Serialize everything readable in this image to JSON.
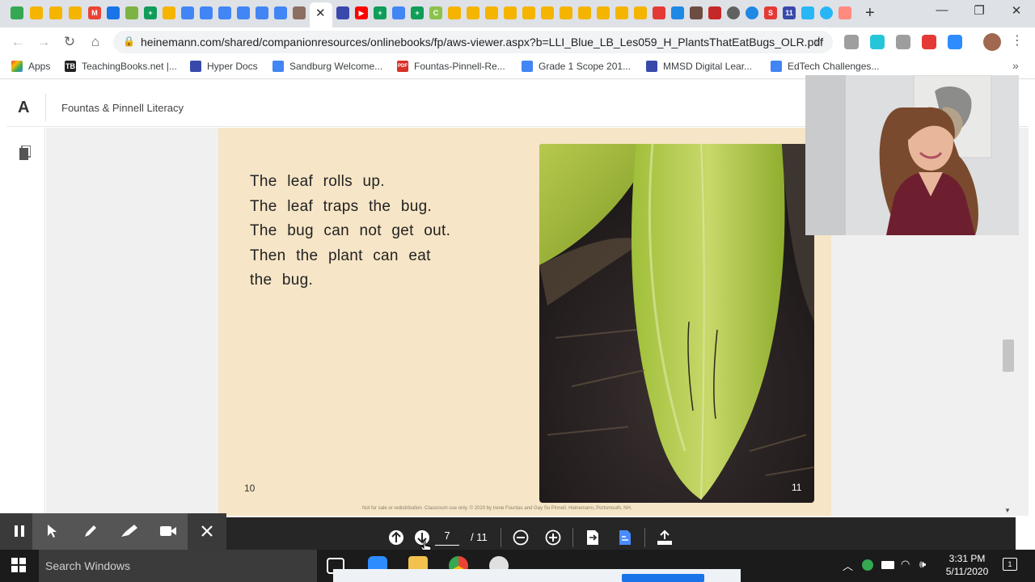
{
  "browser": {
    "tab_close": "✕",
    "new_tab": "+",
    "window": {
      "minimize": "—",
      "restore": "❐",
      "close": "✕"
    },
    "nav": {
      "back": "←",
      "forward": "→",
      "reload": "↻",
      "home": "⌂"
    },
    "url": "heinemann.com/shared/companionresources/onlinebooks/fp/aws-viewer.aspx?b=LLI_Blue_LB_Les059_H_PlantsThatEatBugs_OLR.pdf",
    "star": "☆",
    "kebab": "⋮",
    "bookmarks": [
      {
        "label": "Apps"
      },
      {
        "label": "TeachingBooks.net |..."
      },
      {
        "label": "Hyper Docs"
      },
      {
        "label": "Sandburg Welcome..."
      },
      {
        "label": "Fountas-Pinnell-Re..."
      },
      {
        "label": "Grade 1 Scope 201..."
      },
      {
        "label": "MMSD Digital Lear..."
      },
      {
        "label": "EdTech Challenges..."
      }
    ],
    "bookmarks_more": "»"
  },
  "app": {
    "title": "Fountas & Pinnell Literacy",
    "logo": "A"
  },
  "page": {
    "lines": [
      "The leaf rolls up.",
      "The leaf traps the bug.",
      "The bug can not get out.",
      "Then the plant can eat",
      "the bug."
    ],
    "left_page_number": "10",
    "right_page_number": "11",
    "copyright": "Not for sale or redistribution. Classroom use only. © 2020 by Irene Fountas and Gay Su Pinnell. Heinemann, Portsmouth, NH."
  },
  "pdf_controls": {
    "current_page": "7",
    "total_pages": "/ 11"
  },
  "taskbar": {
    "search_placeholder": "Search Windows",
    "time": "3:31 PM",
    "date": "5/11/2020"
  },
  "icons": {
    "pause": "pause-icon",
    "pointer": "pointer-icon",
    "pen": "pen-icon",
    "highlighter": "highlighter-icon",
    "camera": "video-camera-icon",
    "close": "close-icon"
  },
  "colors": {
    "page_background": "#f6e5c6",
    "control_bar": "#262626",
    "taskbar": "#1b1b1b",
    "chrome_tabstrip": "#dee1e6"
  }
}
